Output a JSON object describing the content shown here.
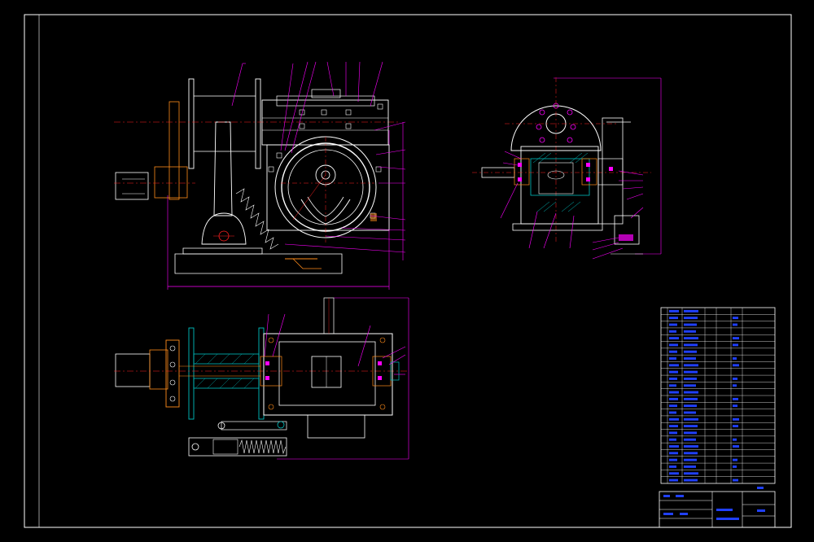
{
  "drawing": {
    "colors": {
      "background": "#000000",
      "frame": "#ffffff",
      "dimension": "#ff00ff",
      "centerline": "#ff2020",
      "part_line": "#ffffff",
      "orange_part": "#ff8c1a",
      "hatch_cyan": "#00c0c0",
      "table_text": "#2040ff",
      "wheel_line": "#ffffff"
    },
    "views": [
      "front-view",
      "side-section-view",
      "top-view"
    ],
    "title_block": {
      "rows": 26,
      "columns": 7
    }
  }
}
